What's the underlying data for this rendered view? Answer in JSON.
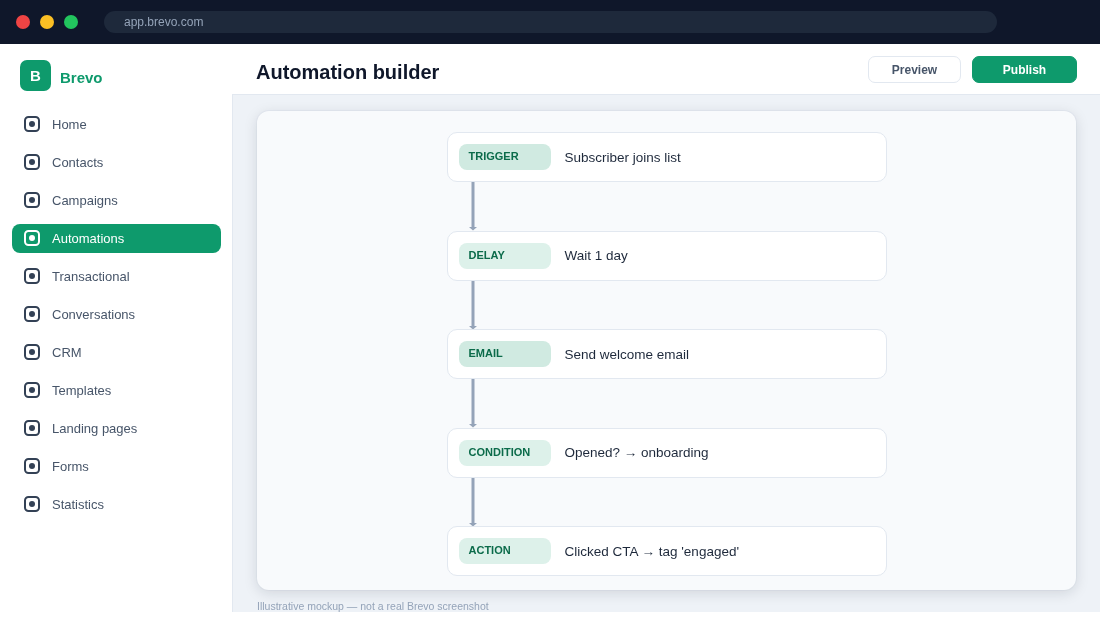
{
  "browser": {
    "url": "app.brevo.com"
  },
  "brand": {
    "logo_letter": "B",
    "name": "Brevo"
  },
  "sidebar": {
    "items": [
      {
        "label": "Home",
        "selected": false
      },
      {
        "label": "Contacts",
        "selected": false
      },
      {
        "label": "Campaigns",
        "selected": false
      },
      {
        "label": "Automations",
        "selected": true
      },
      {
        "label": "Transactional",
        "selected": false
      },
      {
        "label": "Conversations",
        "selected": false
      },
      {
        "label": "CRM",
        "selected": false
      },
      {
        "label": "Templates",
        "selected": false
      },
      {
        "label": "Landing pages",
        "selected": false
      },
      {
        "label": "Forms",
        "selected": false
      },
      {
        "label": "Statistics",
        "selected": false
      }
    ]
  },
  "header": {
    "title": "Automation builder",
    "buttons": [
      {
        "label": "Preview",
        "kind": "secondary"
      },
      {
        "label": "Publish",
        "kind": "primary"
      }
    ]
  },
  "workflow": {
    "steps": [
      {
        "tag": "TRIGGER",
        "text": "Subscriber joins list",
        "color": "#d0eae1"
      },
      {
        "tag": "DELAY",
        "text": "Wait 1 day",
        "color": "#ddf1ea"
      },
      {
        "tag": "EMAIL",
        "text": "Send welcome email",
        "color": "#d0eae1"
      },
      {
        "tag": "CONDITION",
        "text": "Opened? → onboarding",
        "color": "#ddf1ea"
      },
      {
        "tag": "ACTION",
        "text": "Clicked CTA → tag 'engaged'",
        "color": "#ddf1ea"
      }
    ]
  },
  "footnote": "Illustrative mockup — not a real Brevo screenshot"
}
